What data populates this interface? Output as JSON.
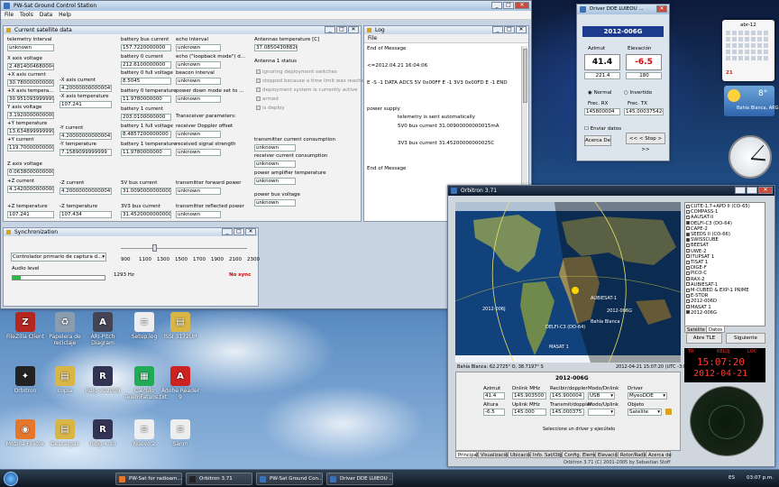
{
  "desktop_icons": [
    {
      "label": "FileZilla Client",
      "color": "#b5261e",
      "glyph": "Z"
    },
    {
      "label": "Papelera de reciclaje",
      "color": "#8a9cb0",
      "glyph": "♻"
    },
    {
      "label": "ARI-Pitch Diagram",
      "color": "#445",
      "glyph": "A"
    },
    {
      "label": "Setup.log",
      "color": "#eee",
      "glyph": "≡"
    },
    {
      "label": "ISSI 3172UH",
      "color": "#d9b545",
      "glyph": "▤"
    },
    {
      "label": "Orbitron",
      "color": "#222",
      "glyph": "✦"
    },
    {
      "label": "copia",
      "color": "#d9b545",
      "glyph": "▤"
    },
    {
      "label": "Rdig-302009",
      "color": "#335",
      "glyph": "R"
    },
    {
      "label": "Cálculo TelemFatuos.txt",
      "color": "#2a5",
      "glyph": "▦"
    },
    {
      "label": "Adobe Reader 9",
      "color": "#c22",
      "glyph": "A"
    },
    {
      "label": "Mozilla Firefox",
      "color": "#e6762b",
      "glyph": "◉"
    },
    {
      "label": "Descargas",
      "color": "#d9b545",
      "glyph": "▤"
    },
    {
      "label": "Rdig 4.30",
      "color": "#335",
      "glyph": "R"
    },
    {
      "label": "Nuevo 2",
      "color": "#eee",
      "glyph": "≡"
    },
    {
      "label": "Sanm",
      "color": "#eee",
      "glyph": "≡"
    }
  ],
  "gcs": {
    "title": "PW-Sat Ground Control Station",
    "menu": [
      "File",
      "Tools",
      "Data",
      "Help"
    ],
    "current": {
      "title": "Current satellite data",
      "telemetry_interval_label": "telemetry interval",
      "telemetry_interval": "unknown",
      "x_axis_voltage_label": "X axis voltage",
      "x_axis_voltage": "2.4814004680004",
      "px_axis_current_label": "+X axis current",
      "px_axis_current": "30.7800000000000",
      "px_axis_temp_label": "+X axis tempera...",
      "px_axis_temp": "30.9510939999999",
      "y_axis_voltage_label": "Y axis voltage",
      "y_axis_voltage": "3.1920000000000",
      "py_axis_temp_label": "+Y temperature",
      "py_axis_temp": "13.6348999999999",
      "py_axis_current_label": "+Y current",
      "py_axis_current": "119.7000000000000",
      "z_axis_voltage_label": "Z axis voltage",
      "z_axis_voltage": "0.0638000000000",
      "pz_current_label": "+Z current",
      "pz_current": "4.1420000000000",
      "pz_temp_label": "+Z temperature",
      "pz_temp": "107.241",
      "mx_current_label": "-X axis current",
      "mx_current": "4.2000000000000455",
      "mx_temp_label": "-X axis temperature",
      "mx_temp": "107.241",
      "my_current_label": "-Y current",
      "my_current": "4.2000000000000455",
      "my_temp_label": "-Y temperature",
      "my_temp": "7.1589099999999",
      "mz_current_label": "-Z current",
      "mz_current": "4.2000000000000455",
      "mz_temp_label": "-Z temperature",
      "mz_temp": "107.434",
      "bat_bus_current_label": "battery bus current",
      "bat_bus_current": "157.7220000000",
      "bat0_current_label": "battery 0 current",
      "bat0_current": "212.6100000000",
      "bat0_voltage_label": "battery 0 full voltage",
      "bat0_voltage": "8.5045",
      "bat0_temp_label": "battery 0 temperature",
      "bat0_temp": "11.9780000000",
      "bat1_current_label": "battery 1 current",
      "bat1_current": "203.0100000000",
      "bat1_voltage_label": "battery 1 full voltage",
      "bat1_voltage": "8.4857200000000",
      "bat1_temp_label": "battery 1 temperature",
      "bat1_temp": "11.9780000000",
      "v5_bus_label": "5V bus current",
      "v5_bus": "31.0090000000000",
      "v3_bus_label": "3V3 bus current",
      "v3_bus": "31.4520000000000",
      "echo_interval_label": "echo interval",
      "echo_interval": "unknown",
      "echo_loopback_label": "echo (\"loopback mode\") d...",
      "echo_loopback": "unknown",
      "beacon_interval_label": "beacon interval",
      "beacon_interval": "unknown",
      "power_down_label": "power down mode set to ...",
      "power_down": "unknown",
      "transceiver_params": "Transceiver parameters:",
      "rx_doppler_label": "receiver Doppler offset",
      "rx_doppler": "unknown",
      "rx_signal_label": "received signal strength",
      "rx_signal": "unknown",
      "tx_fwd_power_label": "transmitter forward power",
      "tx_fwd_power": "unknown",
      "tx_refl_power_label": "transmitter reflected power",
      "tx_refl_power": "unknown",
      "antennas_temp_label": "Antennas temperature [C]",
      "antennas_temp": "37.08504308826",
      "antenna1_status": "Antenna 1 status",
      "checks": [
        "ignoring deployment switches",
        "stopped because a time limit was reached",
        "deployment system is currently active",
        "armed",
        "is deploy"
      ],
      "tx_current_label": "transmitter current consumption",
      "tx_current": "unknown",
      "rcv_current_label": "receiver current consumption",
      "rcv_current": "unknown",
      "pa_temp_label": "power amplifier temperature",
      "pa_temp": "unknown",
      "pbv_label": "power bus voltage",
      "pbv": "unknown"
    },
    "log": {
      "title": "Log",
      "menu": "File",
      "lines": [
        "End of Message",
        "",
        "<=2012.04.21 16:04:06",
        "",
        "E -S -1 DATA ADCS 5V 0x00FF E -1 3V3 0x00FD E -1 END",
        "",
        "",
        "power supply",
        "telemetry is sent automatically",
        "5V0 bus current 31.00900000000015mA",
        "",
        "3V3 bus current 31.45200000000025C",
        "",
        "",
        "End of Message"
      ]
    },
    "sync": {
      "title": "Synchronization",
      "controller": "Controlador primario de captura d...",
      "ticks": [
        "900",
        "1100",
        "1300",
        "1500",
        "1700",
        "1900",
        "2100",
        "2300"
      ],
      "audio_level_label": "Audio level",
      "audio_level_fraction": 0.09,
      "hz": "1293 Hz",
      "status": "No sync"
    }
  },
  "dde": {
    "title": "Driver DDE LUIEOU ...",
    "sat": "2012-006G",
    "azimut_label": "Azimut",
    "elev_label": "Elevación",
    "azimut": "41.4",
    "elev": "-6.5",
    "az2": "221.4",
    "el2": "180",
    "normal": "Normal",
    "invertido": "Invertido",
    "frx_label": "Frec. RX",
    "ftx_label": "Frec. TX",
    "frx": "145800004",
    "ftx": "145.00037542440",
    "send_data": "Enviar datos",
    "acerca": "Acerca De",
    "stop": "<< < Stop > >>"
  },
  "gadgets": {
    "cal_month": "abr-12",
    "cal_day": "21",
    "cal_weekday": "sábado",
    "temp": "8°",
    "city": "Bahía Blanca, ARG"
  },
  "orbitron": {
    "title": "Orbitron 3.71",
    "satellites": [
      "CUTE-1.7+APD II (CO-65)",
      "COMPASS-1",
      "AAUSAT-II",
      "DELFI-C3 (DO-64)",
      "CAPE-2",
      "SEEDS II (CO-66)",
      "SWISSCUBE",
      "BEESAT",
      "UWE-2",
      "ITUPSAT 1",
      "TISAT 1",
      "DIGE-F",
      "PICO-C",
      "RAX-2",
      "AUBIESAT-1",
      "M-CUBED & EXP-1 PRIME",
      "E-STOR",
      "2012-006D",
      "MASAT 1",
      "2012-006G"
    ],
    "sat_checked": [
      false,
      false,
      false,
      true,
      false,
      true,
      true,
      false,
      false,
      false,
      false,
      false,
      false,
      false,
      false,
      false,
      false,
      false,
      false,
      true
    ],
    "list_tabs": [
      "Satélite",
      "Datos"
    ],
    "btn_abre": "Abre TLE",
    "btn_sig": "Siguiente",
    "status_chips": [
      "TR",
      "RELOJ",
      "LOC"
    ],
    "clock": "15:07:20",
    "date": "2012-04-21",
    "map_labels": [
      "2012-006J",
      "DELFI-C3 (DO-64)",
      "AUBIESAT-1",
      "2012-006G",
      "MASAT 1",
      "Bahía Blanca"
    ],
    "status_left": "Bahía Blanca: 62.2725° O, 38.7197° S",
    "status_right": "2012-04-21 15:07:20 (UTC -3:00)",
    "panel_sat": "2012-006G",
    "azimut_label": "Azimut",
    "azimut": "41.4",
    "altura_label": "Altura",
    "altura": "-6.5",
    "dlink_label": "Dnlink MHz",
    "dlink": "145.903500",
    "ulink_label": "Uplink MHz",
    "ulink": "145.000",
    "rdop_label": "Recibir/doppler",
    "rdop": "145.900004",
    "tdop_label": "Transmit/doppler",
    "tdop": "145.000375",
    "mdl_label": "Modo/Dnlink",
    "mdl": "USB",
    "mul_label": "Modo/Uplink",
    "mul": "",
    "driver_label": "Driver",
    "driver": "MyeoDDE",
    "objeto_label": "Objeto",
    "objeto": "Satelite",
    "hint": "Seleccione un driver y ejecútelo",
    "tabs": [
      "Principal",
      "Visualización",
      "Ubicación",
      "Info. Sat/Objeto",
      "Config. Elementos",
      "Elevación",
      "Rotor/Radio",
      "Acerca de"
    ],
    "footer": "Orbitron 3.71 (C) 2001-2005 by Sebastian Stoff"
  },
  "taskbar": {
    "items": [
      "PW-Sat for radioam...",
      "Orbitron 3.71",
      "PW-Sat Ground Con...",
      "Driver DDE LUIEOU ..."
    ],
    "lang": "ES",
    "time": "03:07 p.m."
  }
}
